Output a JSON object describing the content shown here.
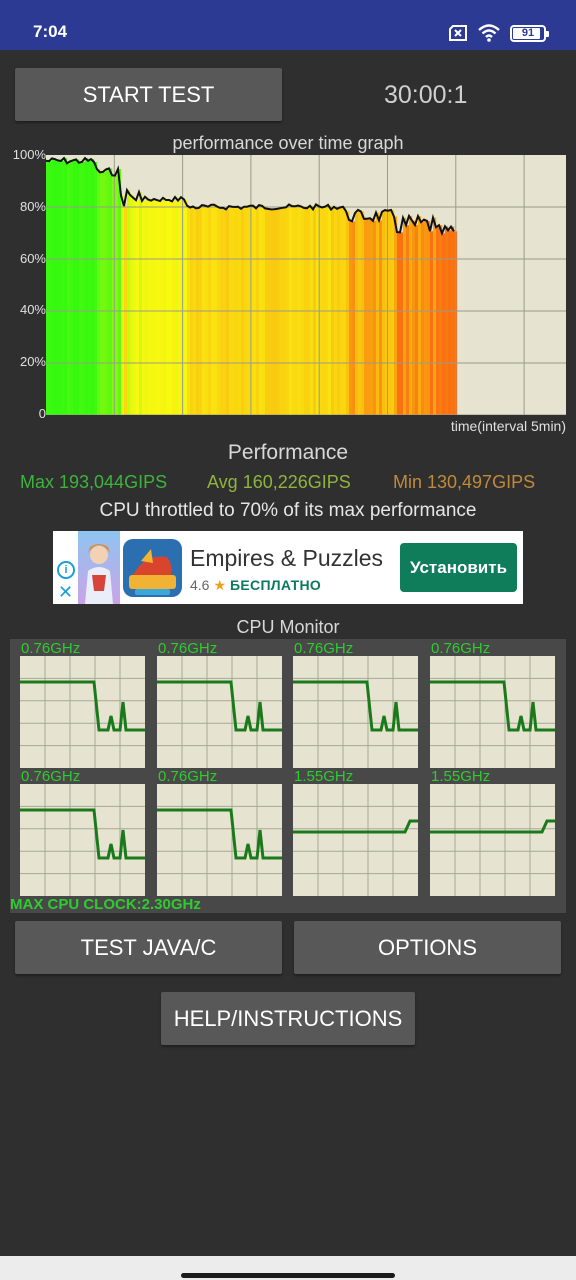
{
  "status_bar": {
    "time": "7:04",
    "battery": "91",
    "battery_level": 0.91
  },
  "controls": {
    "start_label": "START TEST",
    "timer": "30:00:1"
  },
  "graph": {
    "title": "performance over time graph",
    "y_ticks": [
      "100%",
      "80%",
      "60%",
      "40%",
      "20%",
      "0"
    ],
    "x_caption": "time(interval 5min)"
  },
  "performance": {
    "title": "Performance",
    "max": "Max 193,044GIPS",
    "avg": "Avg 160,226GIPS",
    "min": "Min 130,497GIPS",
    "throttle_text": "CPU throttled to 70% of its max performance"
  },
  "ad": {
    "info": "i",
    "close": "✕",
    "title": "Empires & Puzzles",
    "rating": "4.6",
    "price": "БЕСПЛАТНО",
    "install_label": "Установить"
  },
  "cpu_monitor": {
    "title": "CPU Monitor",
    "cores": [
      {
        "freq": "0.76GHz"
      },
      {
        "freq": "0.76GHz"
      },
      {
        "freq": "0.76GHz"
      },
      {
        "freq": "0.76GHz"
      },
      {
        "freq": "0.76GHz"
      },
      {
        "freq": "0.76GHz"
      },
      {
        "freq": "1.55GHz"
      },
      {
        "freq": "1.55GHz"
      }
    ],
    "max_clock": "MAX CPU CLOCK:2.30GHz"
  },
  "buttons": {
    "test_java": "TEST JAVA/C",
    "options": "OPTIONS",
    "help": "HELP/INSTRUCTIONS"
  },
  "colors": {
    "status_bar": "#2d3a94",
    "graph_bg": "#e6e4d0",
    "cpu_line": "#1a7a1a",
    "freq_text": "#2ecc2e",
    "max_color": "#3cb43c",
    "avg_color": "#8fb43c",
    "min_color": "#c08a3a",
    "install_button": "#0f7d5a"
  }
}
